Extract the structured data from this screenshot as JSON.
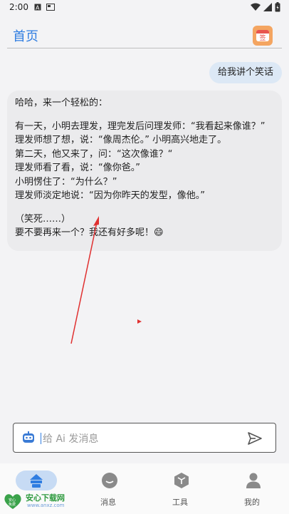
{
  "status_bar": {
    "time": "2:00"
  },
  "header": {
    "title": "首页",
    "sign_in_label": "签"
  },
  "chat": {
    "user_message": "给我讲个笑话",
    "ai_lines": [
      "哈哈，来一个轻松的：",
      "",
      "有一天，小明去理发，理完发后问理发师：“我看起来像谁？”",
      "理发师想了想，说：“像周杰伦。” 小明高兴地走了。",
      "第二天，他又来了，问：“这次像谁？“",
      "理发师看了看，说：“像你爸。”",
      "小明愣住了：“为什么？”",
      "理发师淡定地说：“因为你昨天的发型，像他。”",
      "",
      "（笑死……）",
      "要不要再来一个？我还有好多呢！😄"
    ]
  },
  "input": {
    "placeholder": "给 Ai 发消息"
  },
  "nav": {
    "items": [
      {
        "label": "",
        "icon": "home-icon",
        "active": true
      },
      {
        "label": "消息",
        "icon": "message-icon"
      },
      {
        "label": "工具",
        "icon": "tools-icon"
      },
      {
        "label": "我的",
        "icon": "profile-icon"
      }
    ]
  },
  "watermark": {
    "title": "安心下载网",
    "url": "www.anxz.com",
    "logo_text": "安心\n免费"
  },
  "colors": {
    "accent": "#2f7de1",
    "user_bubble": "#dce8f5",
    "ai_bubble": "#ebebed",
    "annotation": "#e03030"
  }
}
